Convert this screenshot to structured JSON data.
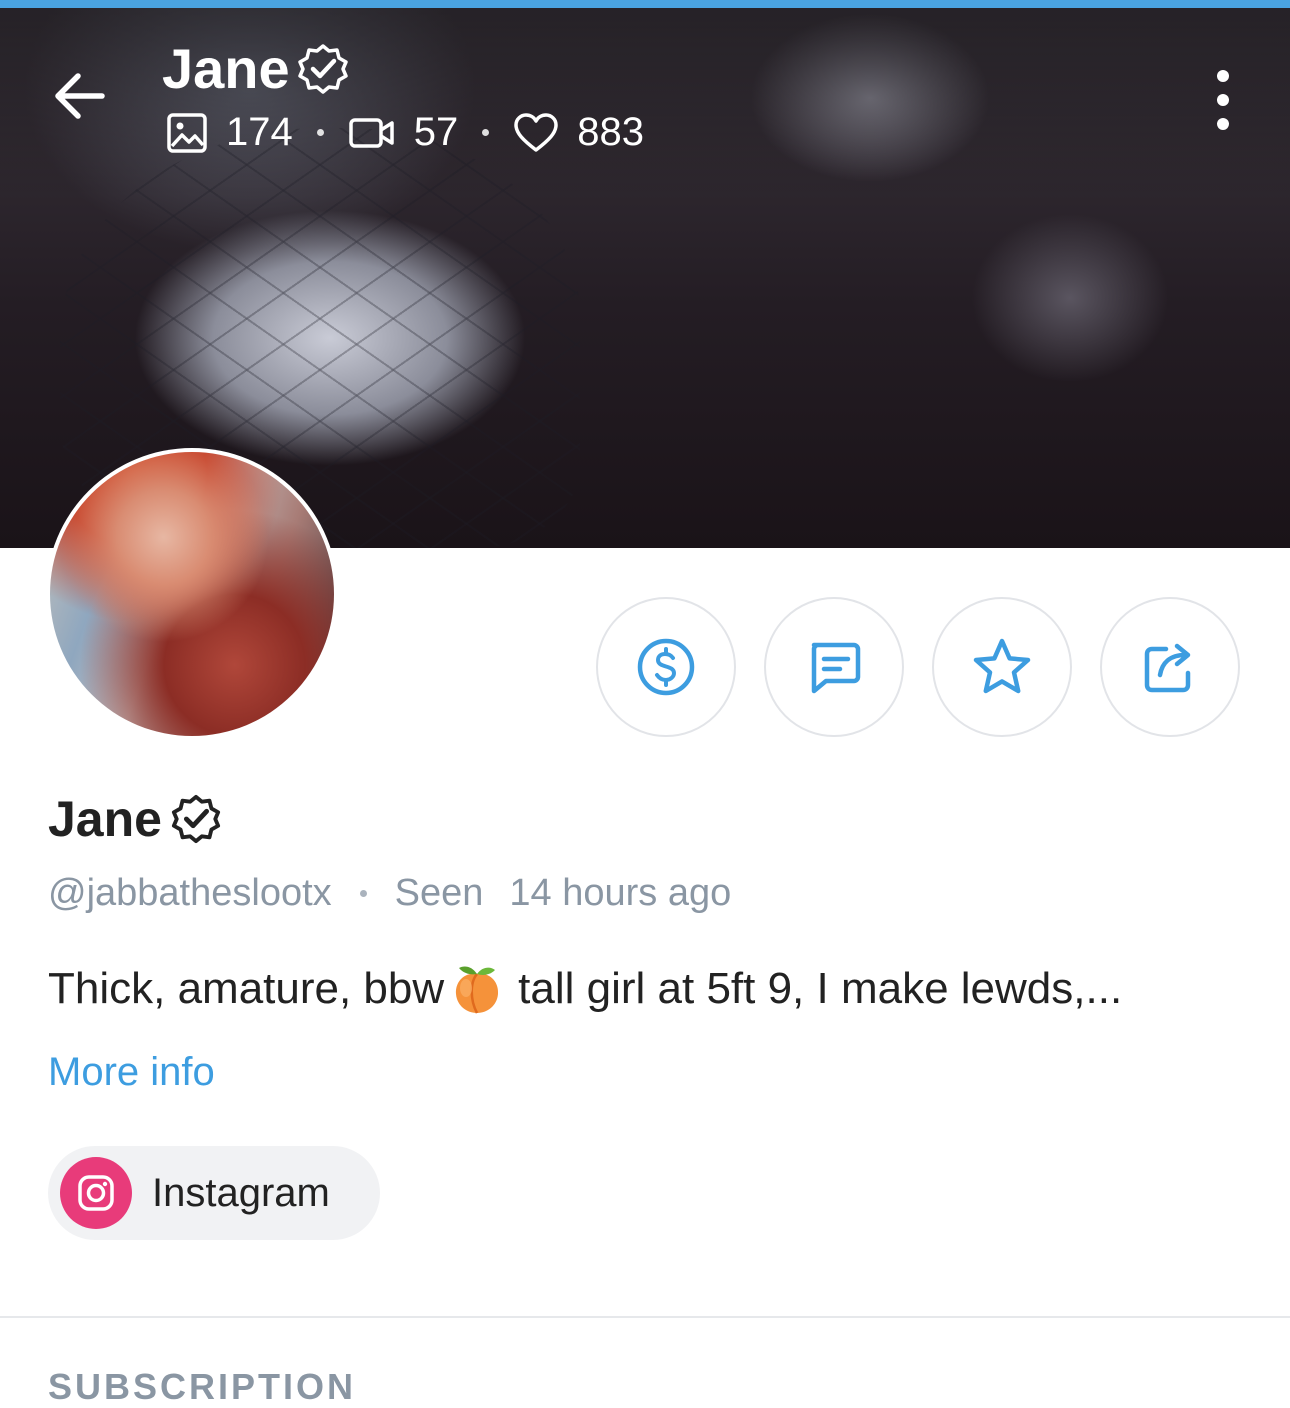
{
  "header": {
    "name": "Jane",
    "stats": {
      "photos": "174",
      "videos": "57",
      "likes": "883"
    }
  },
  "profile": {
    "name": "Jane",
    "handle": "@jabbatheslootx",
    "seen_label": "Seen",
    "seen_time": "14 hours ago",
    "bio_part1": "Thick, amature, bbw",
    "bio_emoji": "peach",
    "bio_part2": "tall girl at 5ft 9, I make lewds,...",
    "more_info": "More info"
  },
  "social": {
    "label": "Instagram"
  },
  "section": {
    "title": "SUBSCRIPTION"
  },
  "colors": {
    "accent": "#3d9de0",
    "instagram": "#e83b7a",
    "muted": "#8a96a3"
  },
  "icons": [
    "back-arrow-icon",
    "verified-badge-icon",
    "image-icon",
    "video-icon",
    "heart-icon",
    "more-vertical-icon",
    "dollar-icon",
    "message-icon",
    "star-icon",
    "share-icon",
    "instagram-icon"
  ]
}
